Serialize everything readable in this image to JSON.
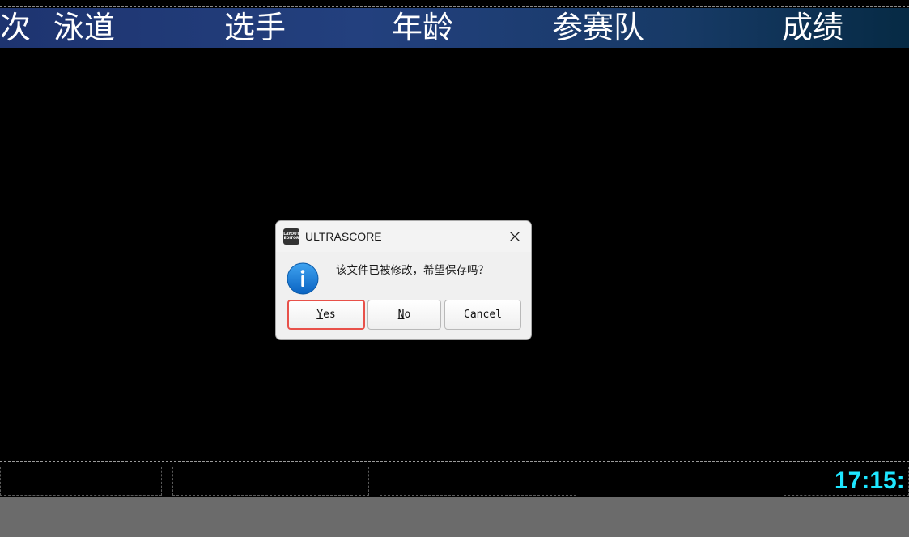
{
  "scoreboard": {
    "header_columns": [
      {
        "label": "次"
      },
      {
        "label": "泳道"
      },
      {
        "label": "选手"
      },
      {
        "label": "年龄"
      },
      {
        "label": "参赛队"
      },
      {
        "label": "成绩"
      }
    ],
    "clock": "17:15:",
    "colors": {
      "header_start": "#1e3470",
      "header_end": "#062a44",
      "clock": "#1ee6ff",
      "background": "#000000"
    }
  },
  "dialog": {
    "app_icon_label": "LAYOUT EDITOR",
    "title": "ULTRASCORE",
    "message": "该文件已被修改，希望保存吗？",
    "icon": "info-icon",
    "buttons": {
      "yes": {
        "mnemonic": "Y",
        "rest": "es"
      },
      "no": {
        "mnemonic": "N",
        "rest": "o"
      },
      "cancel": {
        "label": "Cancel"
      }
    },
    "highlight_color": "#e8514a"
  }
}
